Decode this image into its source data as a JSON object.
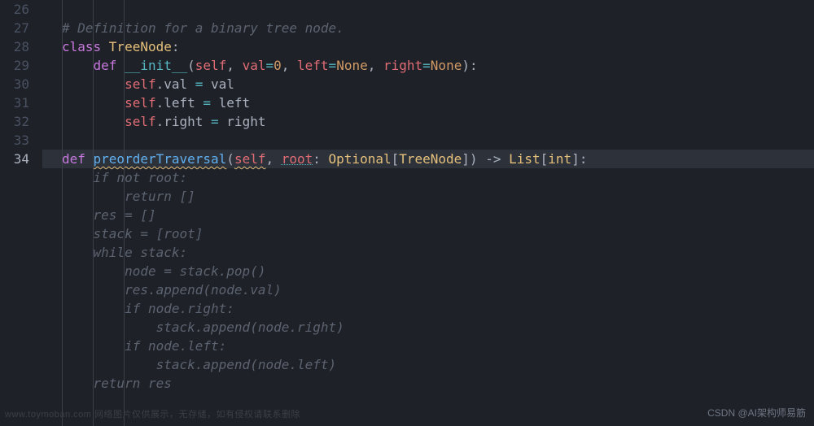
{
  "gutter": {
    "start": 26,
    "lines": [
      "26",
      "27",
      "28",
      "29",
      "30",
      "31",
      "32",
      "33",
      "34"
    ],
    "active_line": 34
  },
  "code": {
    "l27_comment": "# Definition for a binary tree node.",
    "l28_kw": "class ",
    "l28_name": "TreeNode",
    "l28_colon": ":",
    "l29_kw": "def ",
    "l29_name": "__init__",
    "l29_p1": "(",
    "l29_self": "self",
    "l29_c1": ", ",
    "l29_val": "val",
    "l29_eq1": "=",
    "l29_zero": "0",
    "l29_c2": ", ",
    "l29_left": "left",
    "l29_eq2": "=",
    "l29_none1": "None",
    "l29_c3": ", ",
    "l29_right": "right",
    "l29_eq3": "=",
    "l29_none2": "None",
    "l29_p2": "):",
    "l30_self": "self",
    "l30_dot": ".val ",
    "l30_eq": "= ",
    "l30_val": "val",
    "l31_self": "self",
    "l31_dot": ".left ",
    "l31_eq": "= ",
    "l31_val": "left",
    "l32_self": "self",
    "l32_dot": ".right ",
    "l32_eq": "= ",
    "l32_val": "right",
    "l34_kw": "def ",
    "l34_name": "preorderTraversal",
    "l34_p1": "(",
    "l34_self": "self",
    "l34_c1": ", ",
    "l34_root": "root",
    "l34_colon1": ": ",
    "l34_opt": "Optional",
    "l34_b1": "[",
    "l34_tn": "TreeNode",
    "l34_b2": "]",
    "l34_p2": ") ",
    "l34_arrow": "-> ",
    "l34_list": "List",
    "l34_b3": "[",
    "l34_int": "int",
    "l34_b4": "]",
    "l34_colon2": ":"
  },
  "ghost": {
    "g1": "if not root:",
    "g2": "return []",
    "g3": "res = []",
    "g4": "stack = [root]",
    "g5": "while stack:",
    "g6": "node = stack.pop()",
    "g7": "res.append(node.val)",
    "g8": "if node.right:",
    "g9": "stack.append(node.right)",
    "g10": "if node.left:",
    "g11": "stack.append(node.left)",
    "g12": "return res"
  },
  "watermark": "CSDN @AI架构师易筋",
  "watermark2": "www.toymoban.com 网络图片仅供展示，无存储，如有侵权请联系删除"
}
